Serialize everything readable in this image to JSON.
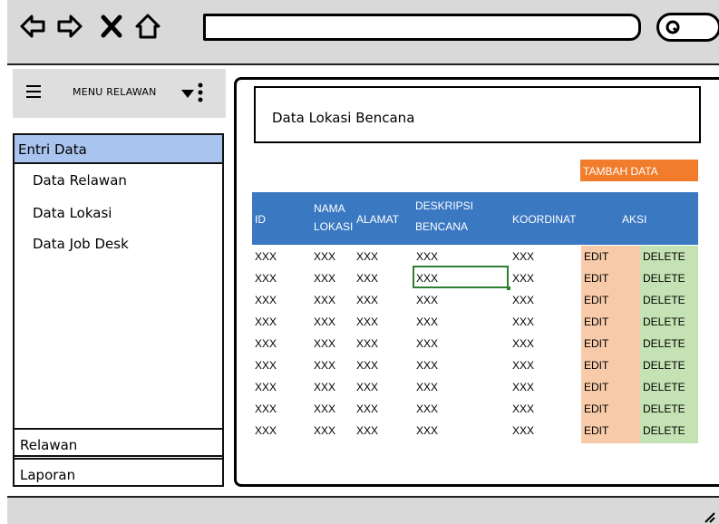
{
  "browser": {
    "nav_icons": [
      "back-arrow-icon",
      "forward-arrow-icon",
      "close-icon",
      "home-icon"
    ],
    "address_value": "",
    "search_icon": "search-icon"
  },
  "sidebar": {
    "menu_title": "MENU RELAWAN",
    "icons": [
      "hamburger-icon",
      "caret-down-icon",
      "vertical-dots-icon"
    ],
    "section_label": "Entri Data",
    "items": [
      {
        "label": "Data Relawan"
      },
      {
        "label": "Data Lokasi"
      },
      {
        "label": "Data Job Desk"
      }
    ],
    "bottom": [
      {
        "label": "Relawan"
      },
      {
        "label": "Laporan"
      }
    ]
  },
  "main": {
    "title": "Data Lokasi Bencana",
    "add_button": "TAMBAH DATA",
    "headers": {
      "id": "ID",
      "nama_1": "NAMA",
      "nama_2": "LOKASI",
      "alamat": "ALAMAT",
      "desk_1": "DESKRIPSI",
      "desk_2": "BENCANA",
      "koordinat": "KOORDINAT",
      "aksi": "AKSI"
    },
    "rows": [
      {
        "id": "XXX",
        "nama": "XXX",
        "alamat": "XXX",
        "deskripsi": "XXX",
        "koordinat": "XXX",
        "edit": "EDIT",
        "delete": "DELETE"
      },
      {
        "id": "XXX",
        "nama": "XXX",
        "alamat": "XXX",
        "deskripsi": "XXX",
        "koordinat": "XXX",
        "edit": "EDIT",
        "delete": "DELETE"
      },
      {
        "id": "XXX",
        "nama": "XXX",
        "alamat": "XXX",
        "deskripsi": "XXX",
        "koordinat": "XXX",
        "edit": "EDIT",
        "delete": "DELETE"
      },
      {
        "id": "XXX",
        "nama": "XXX",
        "alamat": "XXX",
        "deskripsi": "XXX",
        "koordinat": "XXX",
        "edit": "EDIT",
        "delete": "DELETE"
      },
      {
        "id": "XXX",
        "nama": "XXX",
        "alamat": "XXX",
        "deskripsi": "XXX",
        "koordinat": "XXX",
        "edit": "EDIT",
        "delete": "DELETE"
      },
      {
        "id": "XXX",
        "nama": "XXX",
        "alamat": "XXX",
        "deskripsi": "XXX",
        "koordinat": "XXX",
        "edit": "EDIT",
        "delete": "DELETE"
      },
      {
        "id": "XXX",
        "nama": "XXX",
        "alamat": "XXX",
        "deskripsi": "XXX",
        "koordinat": "XXX",
        "edit": "EDIT",
        "delete": "DELETE"
      },
      {
        "id": "XXX",
        "nama": "XXX",
        "alamat": "XXX",
        "deskripsi": "XXX",
        "koordinat": "XXX",
        "edit": "EDIT",
        "delete": "DELETE"
      },
      {
        "id": "XXX",
        "nama": "XXX",
        "alamat": "XXX",
        "deskripsi": "XXX",
        "koordinat": "XXX",
        "edit": "EDIT",
        "delete": "DELETE"
      }
    ]
  },
  "colors": {
    "section_highlight": "#a9c4ef",
    "header_blue": "#3a78c2",
    "add_orange": "#f07c2c",
    "edit_fill": "#f7caa9",
    "delete_fill": "#c4e2b3",
    "selection_green": "#2e7d32"
  }
}
